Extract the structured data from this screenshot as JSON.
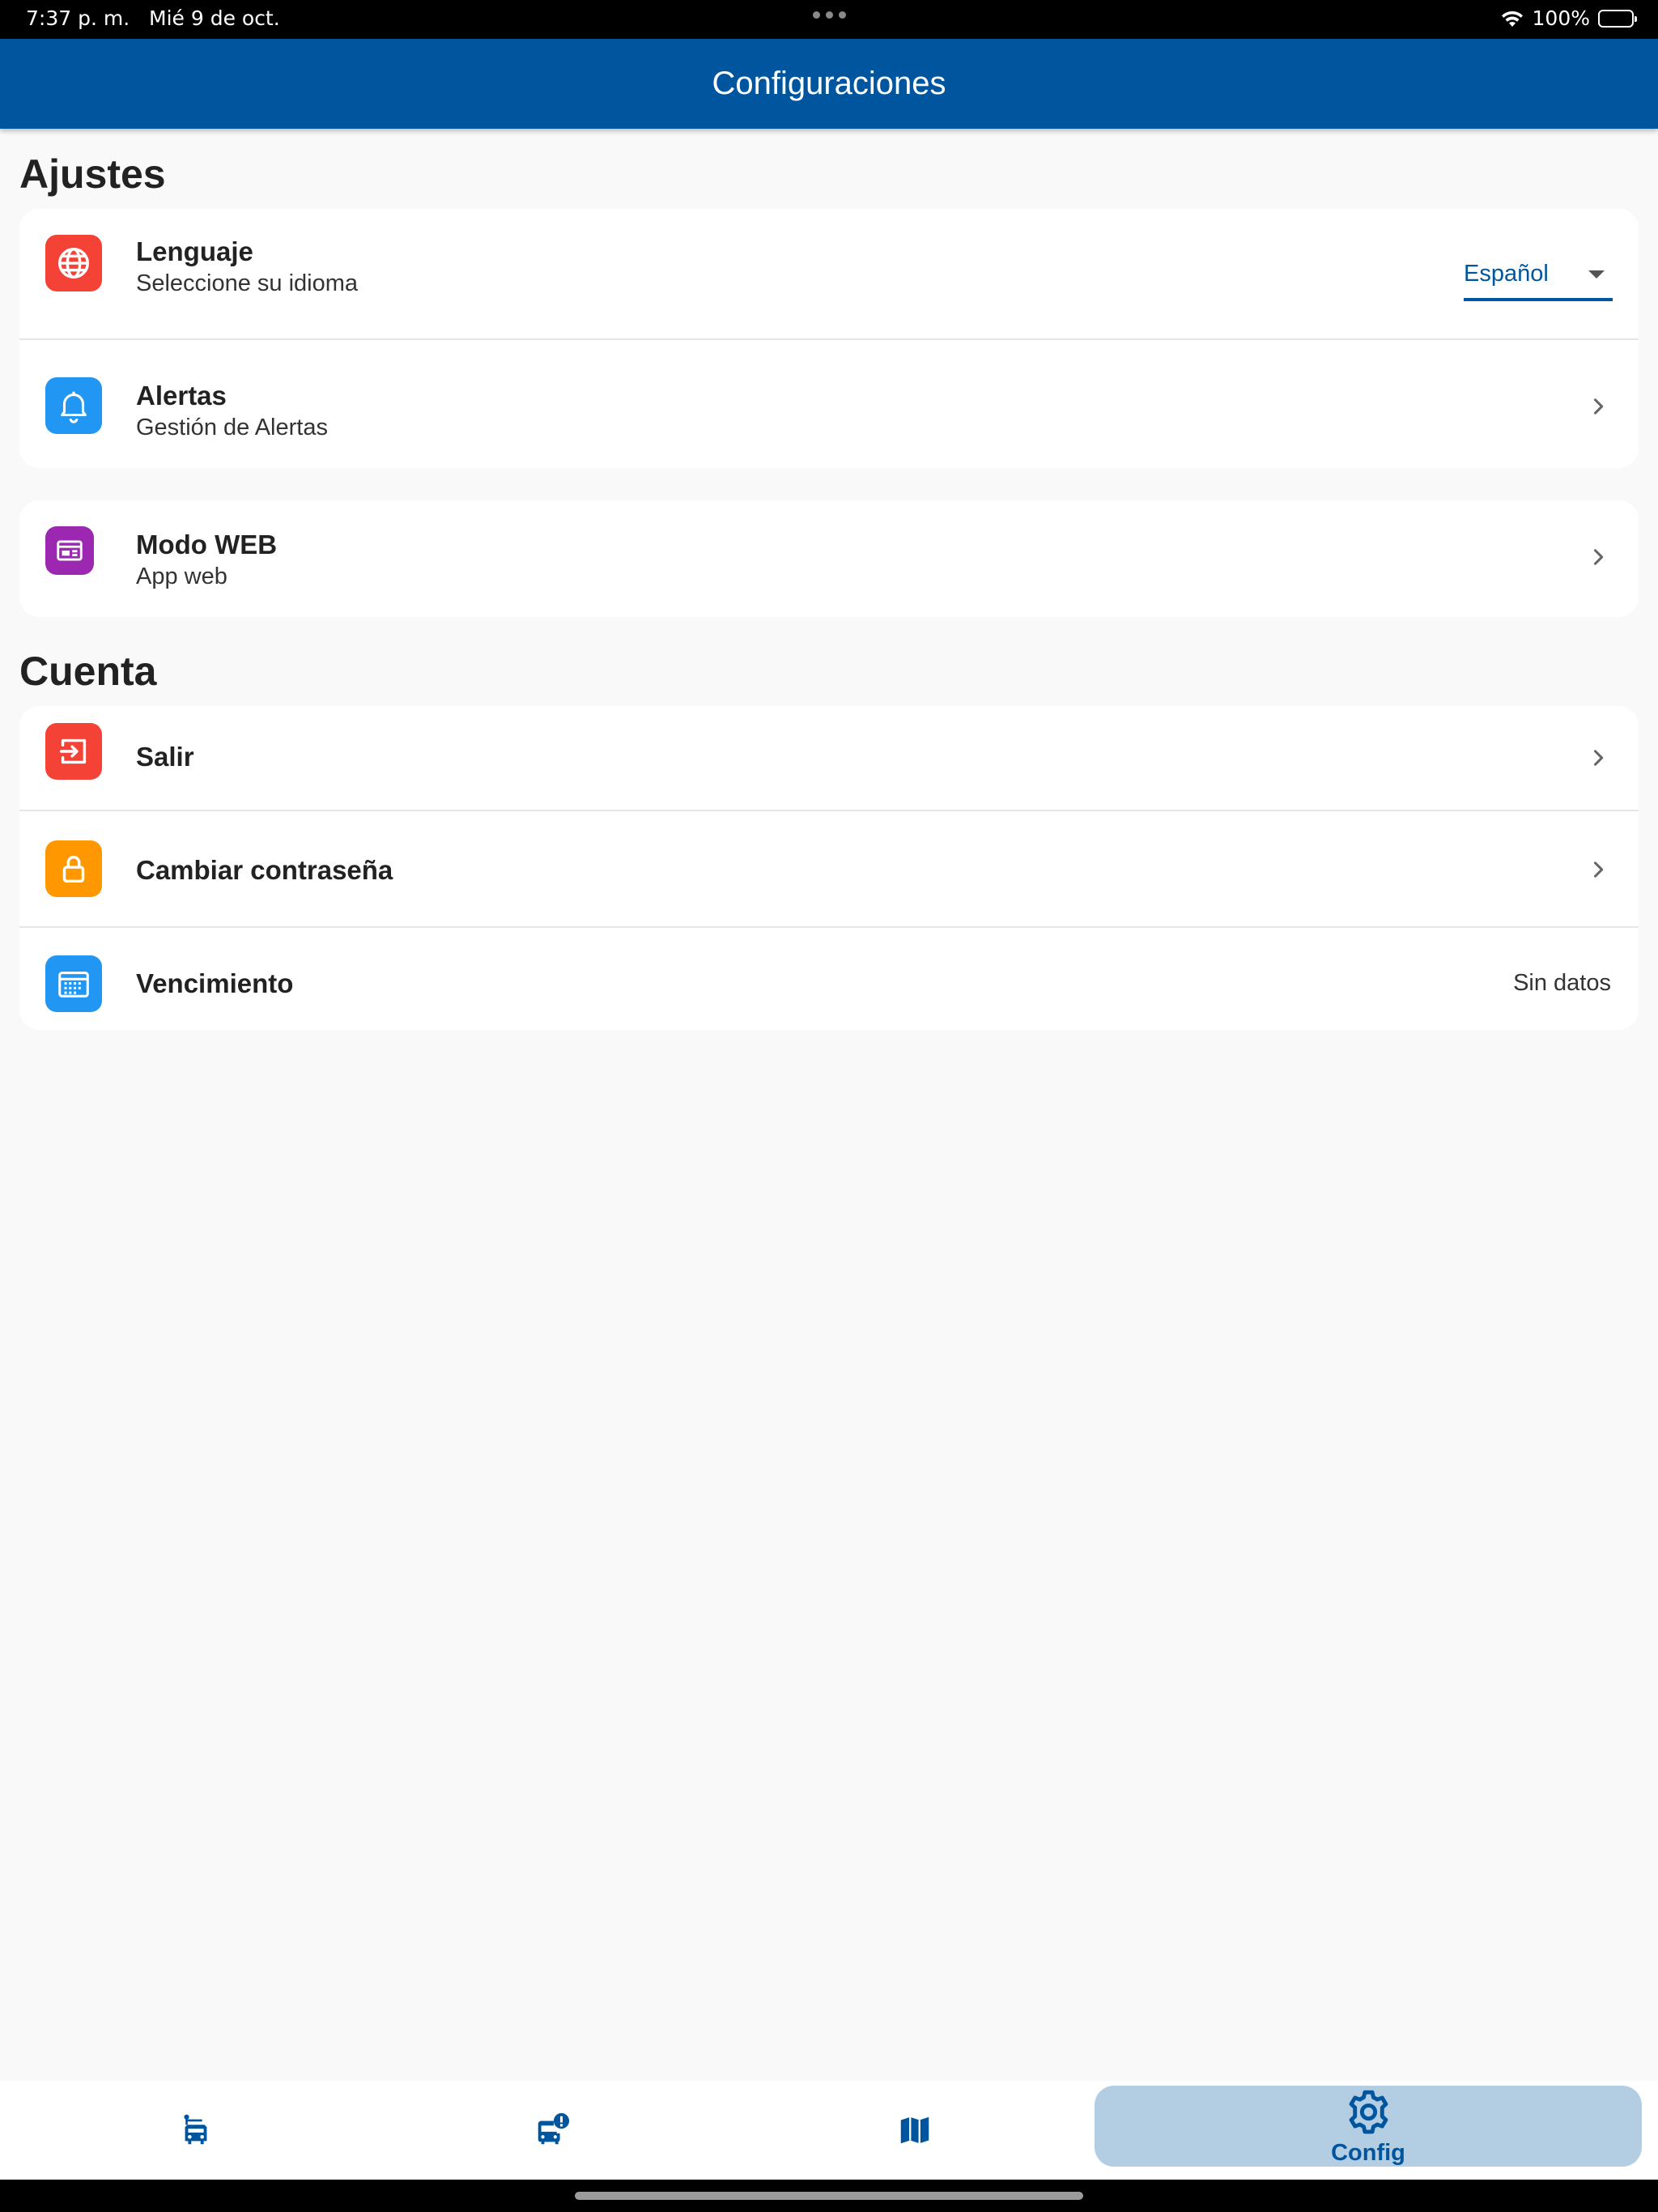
{
  "status_bar": {
    "time": "7:37 p. m.",
    "date": "Mié 9 de oct.",
    "battery": "100%"
  },
  "app_bar": {
    "title": "Configuraciones"
  },
  "sections": {
    "ajustes": {
      "title": "Ajustes",
      "language": {
        "title": "Lenguaje",
        "subtitle": "Seleccione su idioma",
        "selected": "Español"
      },
      "alerts": {
        "title": "Alertas",
        "subtitle": "Gestión de Alertas"
      },
      "web_mode": {
        "title": "Modo WEB",
        "subtitle": "App web"
      }
    },
    "cuenta": {
      "title": "Cuenta",
      "logout": {
        "title": "Salir"
      },
      "change_password": {
        "title": "Cambiar contraseña"
      },
      "expiration": {
        "title": "Vencimiento",
        "value": "Sin datos"
      }
    }
  },
  "bottom_nav": {
    "items": [
      {
        "icon": "vehicle-icon"
      },
      {
        "icon": "bus-alert-icon"
      },
      {
        "icon": "map-icon"
      },
      {
        "icon": "gear-icon",
        "label": "Config",
        "active": true
      }
    ]
  },
  "colors": {
    "primary": "#00569e",
    "red": "#f44336",
    "blue": "#2196f3",
    "purple": "#9c27b0",
    "orange": "#ff9800",
    "nav_active_bg": "#b3cde3"
  }
}
